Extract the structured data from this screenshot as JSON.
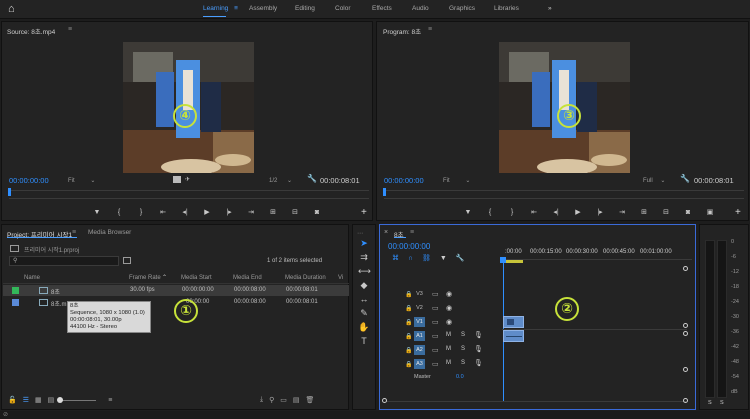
{
  "topbar": {
    "workspaces": [
      "Learning",
      "Assembly",
      "Editing",
      "Color",
      "Effects",
      "Audio",
      "Graphics",
      "Libraries"
    ],
    "active": "Learning",
    "menu_glyph": "≡",
    "overflow": "»"
  },
  "source": {
    "title": "Source: 8초.mp4",
    "timecode_in": "00:00:00:00",
    "fit": "Fit",
    "resolution": "1/2",
    "timecode_out": "00:00:08:01",
    "marker": "④"
  },
  "program": {
    "title": "Program: 8초",
    "timecode_in": "00:00:00:00",
    "fit": "Fit",
    "resolution": "Full",
    "timecode_out": "00:00:08:01",
    "marker": "③"
  },
  "project": {
    "tab_active": "Project: 프리미어 시작1",
    "tab_other": "Media Browser",
    "file_name": "프리미어 시작1.prproj",
    "selection_info": "1 of 2 items selected",
    "columns": [
      "Name",
      "Frame Rate",
      "Media Start",
      "Media End",
      "Media Duration",
      "Vi"
    ],
    "rows": [
      {
        "name": "8초",
        "frame_rate": "30.00 fps",
        "media_start": "00:00:00:00",
        "media_end": "00:00:08:00",
        "media_duration": "00:00:08:01"
      },
      {
        "name": "8초.m",
        "frame_rate": "",
        "media_start": "00:00:00",
        "media_end": "00:00:08:00",
        "media_duration": "00:00:08:01"
      }
    ],
    "tooltip": [
      "8초",
      "Sequence, 1080 x 1080 (1.0)",
      "00:00:08:01, 30.00p",
      "44100 Hz - Stereo"
    ],
    "marker": "①"
  },
  "timeline": {
    "tab": "8초",
    "timecode": "00:00:00:00",
    "ruler": [
      ":00:00",
      "00:00:15:00",
      "00:00:30:00",
      "00:00:45:00",
      "00:01:00:00"
    ],
    "tracks": {
      "video": [
        {
          "name": "V3"
        },
        {
          "name": "V2"
        },
        {
          "name": "V1",
          "selected": true
        }
      ],
      "audio": [
        {
          "name": "A1"
        },
        {
          "name": "A2"
        },
        {
          "name": "A3"
        }
      ],
      "master_label": "Master",
      "master_value": "0.0"
    },
    "marker": "②"
  },
  "meter": {
    "levels": [
      "0",
      "-6",
      "-12",
      "-18",
      "-24",
      "-30",
      "-36",
      "-42",
      "-48",
      "-54",
      "dB"
    ],
    "bottom": [
      "S",
      "S"
    ]
  }
}
